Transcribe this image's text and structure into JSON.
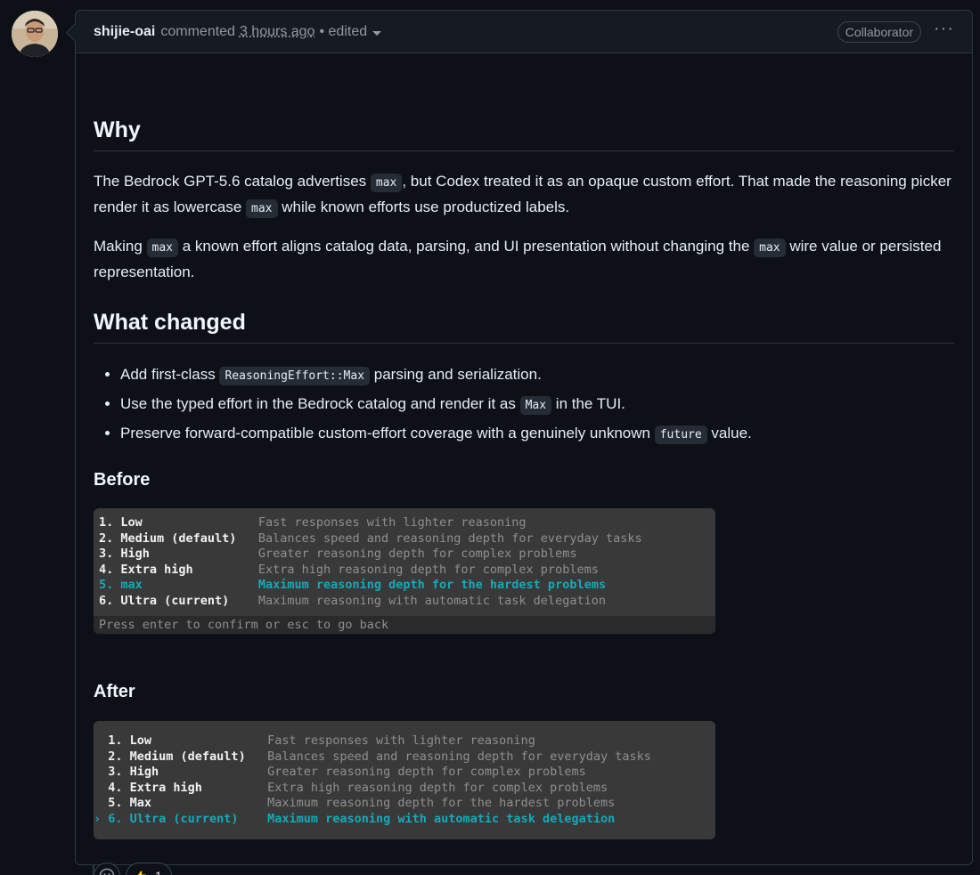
{
  "comment": {
    "author": "shijie-oai",
    "verb": "commented",
    "time": "3 hours ago",
    "edited": "• edited",
    "badge": "Collaborator"
  },
  "why": {
    "heading": "Why",
    "p1": {
      "t1": "The Bedrock GPT-5.6 catalog advertises ",
      "c1": "max",
      "t2": ", but Codex treated it as an opaque custom effort. That made the reasoning picker render it as lowercase ",
      "c2": "max",
      "t3": " while known efforts use productized labels."
    },
    "p2": {
      "t1": "Making ",
      "c1": "max",
      "t2": " a known effort aligns catalog data, parsing, and UI presentation without changing the ",
      "c2": "max",
      "t3": " wire value or persisted representation."
    }
  },
  "what_changed": {
    "heading": "What changed",
    "items": [
      {
        "t1": "Add first-class ",
        "c1": "ReasoningEffort::Max",
        "t2": " parsing and serialization."
      },
      {
        "t1": "Use the typed effort in the Bedrock catalog and render it as ",
        "c1": "Max",
        "t2": " in the TUI."
      },
      {
        "t1": "Preserve forward-compatible custom-effort coverage with a genuinely unknown ",
        "c1": "future",
        "t2": " value."
      }
    ]
  },
  "before": {
    "heading": "Before",
    "rows": [
      {
        "label": "1. Low             ",
        "desc": "Fast responses with lighter reasoning"
      },
      {
        "label": "2. Medium (default)",
        "desc": "Balances speed and reasoning depth for everyday tasks"
      },
      {
        "label": "3. High            ",
        "desc": "Greater reasoning depth for complex problems"
      },
      {
        "label": "4. Extra high      ",
        "desc": "Extra high reasoning depth for complex problems"
      },
      {
        "label": "5. max             ",
        "desc": "Maximum reasoning depth for the hardest problems"
      },
      {
        "label": "6. Ultra (current) ",
        "desc": "Maximum reasoning with automatic task delegation"
      }
    ],
    "footer": "Press enter to confirm or esc to go back"
  },
  "after": {
    "heading": "After",
    "rows": [
      {
        "prefix": "  ",
        "label": "1. Low             ",
        "desc": "Fast responses with lighter reasoning"
      },
      {
        "prefix": "  ",
        "label": "2. Medium (default)",
        "desc": "Balances speed and reasoning depth for everyday tasks"
      },
      {
        "prefix": "  ",
        "label": "3. High            ",
        "desc": "Greater reasoning depth for complex problems"
      },
      {
        "prefix": "  ",
        "label": "4. Extra high      ",
        "desc": "Extra high reasoning depth for complex problems"
      },
      {
        "prefix": "  ",
        "label": "5. Max             ",
        "desc": "Maximum reasoning depth for the hardest problems"
      },
      {
        "prefix": "› ",
        "label": "6. Ultra (current) ",
        "desc": "Maximum reasoning with automatic task delegation"
      }
    ]
  },
  "reactions": {
    "thumbs_up_count": "1"
  },
  "icons": {
    "smiley": "smiley-icon",
    "thumbs_up": "thumbs-up-icon",
    "kebab": "kebab-horizontal-icon"
  }
}
